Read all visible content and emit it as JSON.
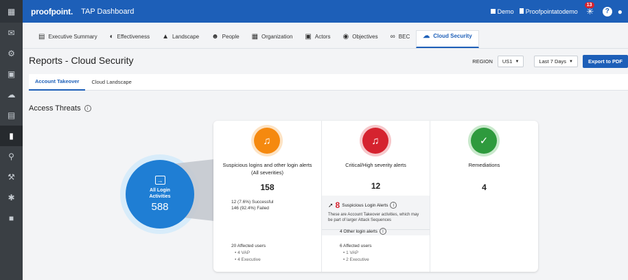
{
  "topbar": {
    "brand": "proofpoint.",
    "app_title": "TAP Dashboard",
    "demo_label": "Demo",
    "org_label": "Proofpointatodemo",
    "notification_count": "13"
  },
  "nav_tabs": [
    {
      "label": "Executive Summary",
      "icon": "document-icon"
    },
    {
      "label": "Effectiveness",
      "icon": "pie-icon"
    },
    {
      "label": "Landscape",
      "icon": "image-icon"
    },
    {
      "label": "People",
      "icon": "people-icon"
    },
    {
      "label": "Organization",
      "icon": "org-icon"
    },
    {
      "label": "Actors",
      "icon": "contact-icon"
    },
    {
      "label": "Objectives",
      "icon": "target-icon"
    },
    {
      "label": "BEC",
      "icon": "mask-icon"
    },
    {
      "label": "Cloud Security",
      "icon": "cloud-icon"
    }
  ],
  "page": {
    "title": "Reports - Cloud Security",
    "region_label": "REGION",
    "region_value": "US1",
    "range_value": "Last 7 Days",
    "export_label": "Export to PDF"
  },
  "sub_tabs": [
    "Account Takeover",
    "Cloud Landscape"
  ],
  "section_title": "Access Threats",
  "summary": {
    "label_line1": "All Login",
    "label_line2": "Activities",
    "value": "588"
  },
  "columns": {
    "suspicious": {
      "title": "Suspicious logins and other login alerts (All severities)",
      "value": "158",
      "successful": "12 (7.6%) Successful",
      "failed": "146 (92.4%) Failed",
      "affected": "20 Affected users",
      "vap": "• 4 VAP",
      "exec": "• 4 Executive"
    },
    "critical": {
      "title": "Critical/High severity alerts",
      "value": "12",
      "suspicious_count": "8",
      "suspicious_label": "Suspicious Login Alerts",
      "note": "These are Account Takeover activities, which may be part of larger Attack Sequences",
      "other_alerts": "4 Other login alerts",
      "affected": "6 Affected users",
      "vap": "• 1 VAP",
      "exec": "• 2 Executive"
    },
    "remediations": {
      "title": "Remediations",
      "value": "4"
    }
  },
  "colors": {
    "brand_blue": "#1d5fb8",
    "orange": "#f5890f",
    "red": "#d5232f",
    "green": "#2e9a3d",
    "circle_blue": "#1f7ed4"
  }
}
